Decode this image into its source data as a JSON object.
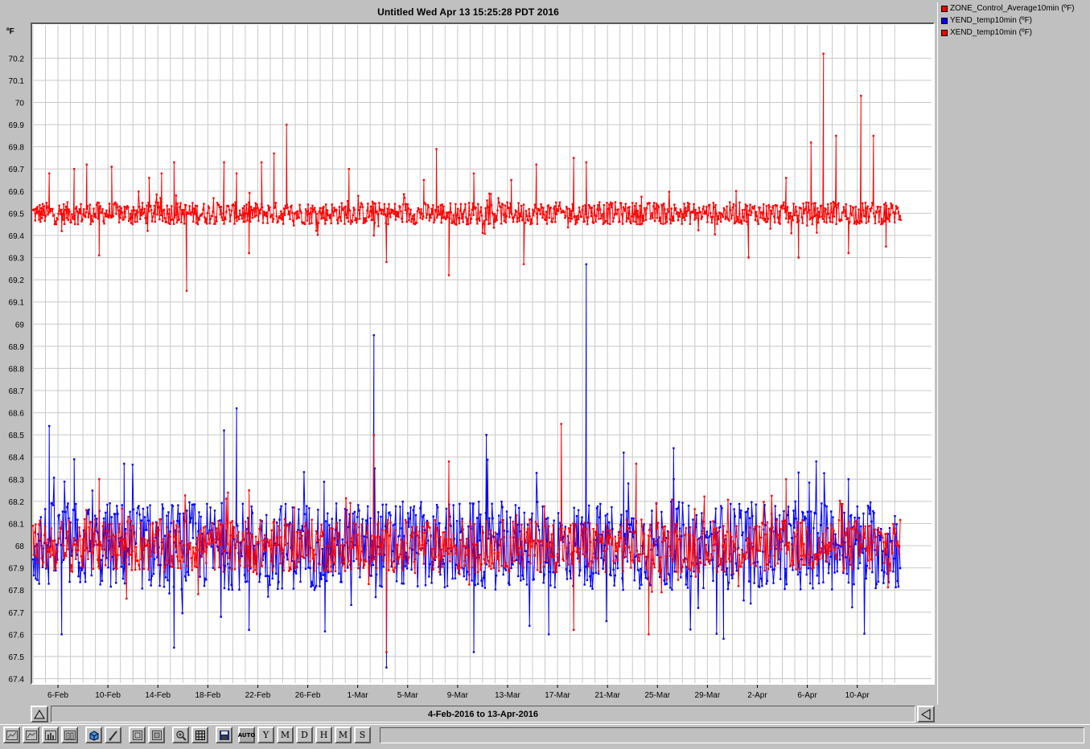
{
  "window": {
    "title": "Untitled Wed Apr 13 15:25:28 PDT 2016"
  },
  "axis": {
    "unit": "ºF"
  },
  "legend": [
    {
      "label": "ZONE_Control_Average10min (ºF)",
      "color": "#ff0000"
    },
    {
      "label": "YEND_temp10min (ºF)",
      "color": "#0000ff"
    },
    {
      "label": "XEND_temp10min (ºF)",
      "color": "#ff0000"
    }
  ],
  "range": {
    "label": "4-Feb-2016 to 13-Apr-2016"
  },
  "toolbar": {
    "buttons": [
      {
        "name": "line-chart-icon",
        "glyph": ""
      },
      {
        "name": "area-chart-icon",
        "glyph": ""
      },
      {
        "name": "bar-chart-icon",
        "glyph": ""
      },
      {
        "name": "column-chart-icon",
        "glyph": ""
      },
      {
        "name": "3d-icon",
        "glyph": ""
      },
      {
        "name": "brush-icon",
        "glyph": ""
      },
      {
        "name": "zoom-fit-icon",
        "glyph": ""
      },
      {
        "name": "zoom-box-icon",
        "glyph": ""
      },
      {
        "name": "magnify-icon",
        "glyph": ""
      },
      {
        "name": "grid-icon",
        "glyph": ""
      },
      {
        "name": "save-icon",
        "glyph": ""
      },
      {
        "name": "auto-button",
        "glyph": "AUTO"
      },
      {
        "name": "year-button",
        "glyph": "Y"
      },
      {
        "name": "month-button",
        "glyph": "M"
      },
      {
        "name": "day-button",
        "glyph": "D"
      },
      {
        "name": "hour-button",
        "glyph": "H"
      },
      {
        "name": "minute-button",
        "glyph": "M"
      },
      {
        "name": "second-button",
        "glyph": "S"
      }
    ]
  },
  "chart_data": {
    "type": "line",
    "title": "Untitled Wed Apr 13 15:25:28 PDT 2016",
    "ylabel": "ºF",
    "xlabel": "",
    "x_range": [
      "2016-02-04",
      "2016-04-13"
    ],
    "ylim": [
      67.38,
      70.35
    ],
    "y_ticks": [
      67.4,
      67.5,
      67.6,
      67.7,
      67.8,
      67.9,
      68,
      68.1,
      68.2,
      68.3,
      68.4,
      68.5,
      68.6,
      68.7,
      68.8,
      68.9,
      69,
      69.1,
      69.2,
      69.3,
      69.4,
      69.5,
      69.6,
      69.7,
      69.8,
      69.9,
      70,
      70.1,
      70.2
    ],
    "x_ticks": [
      {
        "label": "6-Feb",
        "date": "2016-02-06"
      },
      {
        "label": "10-Feb",
        "date": "2016-02-10"
      },
      {
        "label": "14-Feb",
        "date": "2016-02-14"
      },
      {
        "label": "18-Feb",
        "date": "2016-02-18"
      },
      {
        "label": "22-Feb",
        "date": "2016-02-22"
      },
      {
        "label": "26-Feb",
        "date": "2016-02-26"
      },
      {
        "label": "1-Mar",
        "date": "2016-03-01"
      },
      {
        "label": "5-Mar",
        "date": "2016-03-05"
      },
      {
        "label": "9-Mar",
        "date": "2016-03-09"
      },
      {
        "label": "13-Mar",
        "date": "2016-03-13"
      },
      {
        "label": "17-Mar",
        "date": "2016-03-17"
      },
      {
        "label": "21-Mar",
        "date": "2016-03-21"
      },
      {
        "label": "25-Mar",
        "date": "2016-03-25"
      },
      {
        "label": "29-Mar",
        "date": "2016-03-29"
      },
      {
        "label": "2-Apr",
        "date": "2016-04-02"
      },
      {
        "label": "6-Apr",
        "date": "2016-04-06"
      },
      {
        "label": "10-Apr",
        "date": "2016-04-10"
      }
    ],
    "grid": true,
    "legend_position": "right",
    "series": [
      {
        "name": "ZONE_Control_Average10min (ºF)",
        "color": "#ff0000",
        "baseline": 69.5,
        "noise": 0.05,
        "points": [
          [
            "2016-02-04",
            69.5
          ],
          [
            "2016-02-05",
            69.68
          ],
          [
            "2016-02-06",
            69.42
          ],
          [
            "2016-02-07",
            69.7
          ],
          [
            "2016-02-08",
            69.72
          ],
          [
            "2016-02-09",
            69.31
          ],
          [
            "2016-02-10",
            69.71
          ],
          [
            "2016-02-13",
            69.66
          ],
          [
            "2016-02-14",
            69.68
          ],
          [
            "2016-02-15",
            69.73
          ],
          [
            "2016-02-16",
            69.15
          ],
          [
            "2016-02-19",
            69.73
          ],
          [
            "2016-02-20",
            69.68
          ],
          [
            "2016-02-21",
            69.32
          ],
          [
            "2016-02-22",
            69.73
          ],
          [
            "2016-02-23",
            69.77
          ],
          [
            "2016-02-24",
            69.9
          ],
          [
            "2016-02-29",
            69.7
          ],
          [
            "2016-03-02",
            69.4
          ],
          [
            "2016-03-03",
            69.28
          ],
          [
            "2016-03-06",
            69.65
          ],
          [
            "2016-03-07",
            69.79
          ],
          [
            "2016-03-08",
            69.22
          ],
          [
            "2016-03-10",
            69.68
          ],
          [
            "2016-03-13",
            69.65
          ],
          [
            "2016-03-14",
            69.27
          ],
          [
            "2016-03-15",
            69.72
          ],
          [
            "2016-03-18",
            69.75
          ],
          [
            "2016-03-19",
            69.73
          ],
          [
            "2016-03-31",
            69.6
          ],
          [
            "2016-04-01",
            69.3
          ],
          [
            "2016-04-04",
            69.66
          ],
          [
            "2016-04-05",
            69.3
          ],
          [
            "2016-04-06",
            69.82
          ],
          [
            "2016-04-07",
            70.22
          ],
          [
            "2016-04-08",
            69.85
          ],
          [
            "2016-04-09",
            69.32
          ],
          [
            "2016-04-10",
            70.03
          ],
          [
            "2016-04-11",
            69.85
          ],
          [
            "2016-04-12",
            69.35
          ],
          [
            "2016-04-13",
            69.5
          ]
        ]
      },
      {
        "name": "YEND_temp10min (ºF)",
        "color": "#0000ff",
        "baseline": 68.0,
        "noise": 0.2,
        "points": [
          [
            "2016-02-04",
            68.0
          ],
          [
            "2016-02-05",
            68.54
          ],
          [
            "2016-02-06",
            67.6
          ],
          [
            "2016-02-07",
            68.39
          ],
          [
            "2016-02-11",
            68.37
          ],
          [
            "2016-02-15",
            67.54
          ],
          [
            "2016-02-19",
            68.52
          ],
          [
            "2016-02-20",
            68.62
          ],
          [
            "2016-02-21",
            67.62
          ],
          [
            "2016-03-02",
            68.95
          ],
          [
            "2016-03-03",
            67.45
          ],
          [
            "2016-03-10",
            67.52
          ],
          [
            "2016-03-11",
            68.5
          ],
          [
            "2016-03-16",
            67.6
          ],
          [
            "2016-03-19",
            69.27
          ],
          [
            "2016-03-22",
            68.42
          ],
          [
            "2016-03-26",
            68.44
          ],
          [
            "2016-03-30",
            67.58
          ],
          [
            "2016-04-05",
            68.33
          ],
          [
            "2016-04-09",
            68.3
          ],
          [
            "2016-04-13",
            68.0
          ]
        ]
      },
      {
        "name": "XEND_temp10min (ºF)",
        "color": "#ff0000",
        "baseline": 68.0,
        "noise": 0.12,
        "points": [
          [
            "2016-02-04",
            68.0
          ],
          [
            "2016-02-09",
            68.3
          ],
          [
            "2016-02-21",
            68.25
          ],
          [
            "2016-03-02",
            68.5
          ],
          [
            "2016-03-03",
            67.52
          ],
          [
            "2016-03-08",
            68.38
          ],
          [
            "2016-03-17",
            68.55
          ],
          [
            "2016-03-18",
            67.62
          ],
          [
            "2016-03-23",
            68.37
          ],
          [
            "2016-03-24",
            67.6
          ],
          [
            "2016-04-04",
            68.3
          ],
          [
            "2016-04-13",
            68.0
          ]
        ]
      }
    ]
  }
}
